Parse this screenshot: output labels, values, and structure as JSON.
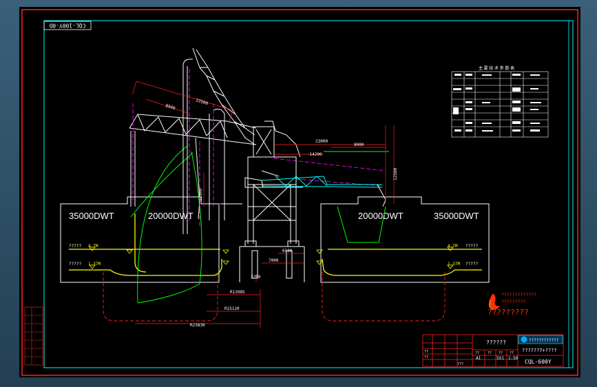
{
  "colors": {
    "sheet": "#000000",
    "outer_frame": "#ff2020",
    "inner_frame": "#00ffff",
    "hull": "#ffffff",
    "waterline": "#ffff00",
    "structure": "#ff00ff",
    "arc": "#00ff00",
    "dimension": "#ff2020",
    "table": "#ffffff",
    "accent_cyan": "#00ffff"
  },
  "drawing": {
    "code_label": "CQL-100Y-0D",
    "ship_labels": {
      "left_large": "35000DWT",
      "left_small": "20000DWT",
      "right_small": "20000DWT",
      "right_large": "35000DWT"
    },
    "waterline_labels": {
      "left_upper_text": "?????",
      "left_upper_value": "4.7M",
      "left_lower_text": "?????",
      "left_lower_value": "1.37M",
      "right_upper_value": "4.7M",
      "right_upper_text": "?????",
      "right_lower_value": "1.37M",
      "right_lower_text": "?????"
    },
    "dimensions": {
      "boom_long": "22500",
      "boom_short": "8940",
      "arm_total": "23000",
      "arm_part": "8000",
      "offset": "-14200",
      "vertical": "12500",
      "column": "12000",
      "base_1": "7000",
      "base_2": "6500",
      "base_3": "2200",
      "radius_1": "R13985",
      "radius_2": "R15120",
      "radius_3": "R23830"
    },
    "spec_table": {
      "title": "主 要 技 术 参 数 表"
    }
  },
  "company": {
    "name_lines": [
      "?????????????",
      "?????????"
    ],
    "tagline": "?????????",
    "qq_text": "????????????"
  },
  "title_block": {
    "drawing_title": "??????",
    "subtitle": "??????7+????",
    "scale_cells": [
      "A1",
      "5X1",
      "1:50"
    ],
    "code": "CQL-600Y",
    "rows": [
      "??",
      "??",
      "??",
      "??",
      "??",
      "??"
    ],
    "mark": "???"
  }
}
